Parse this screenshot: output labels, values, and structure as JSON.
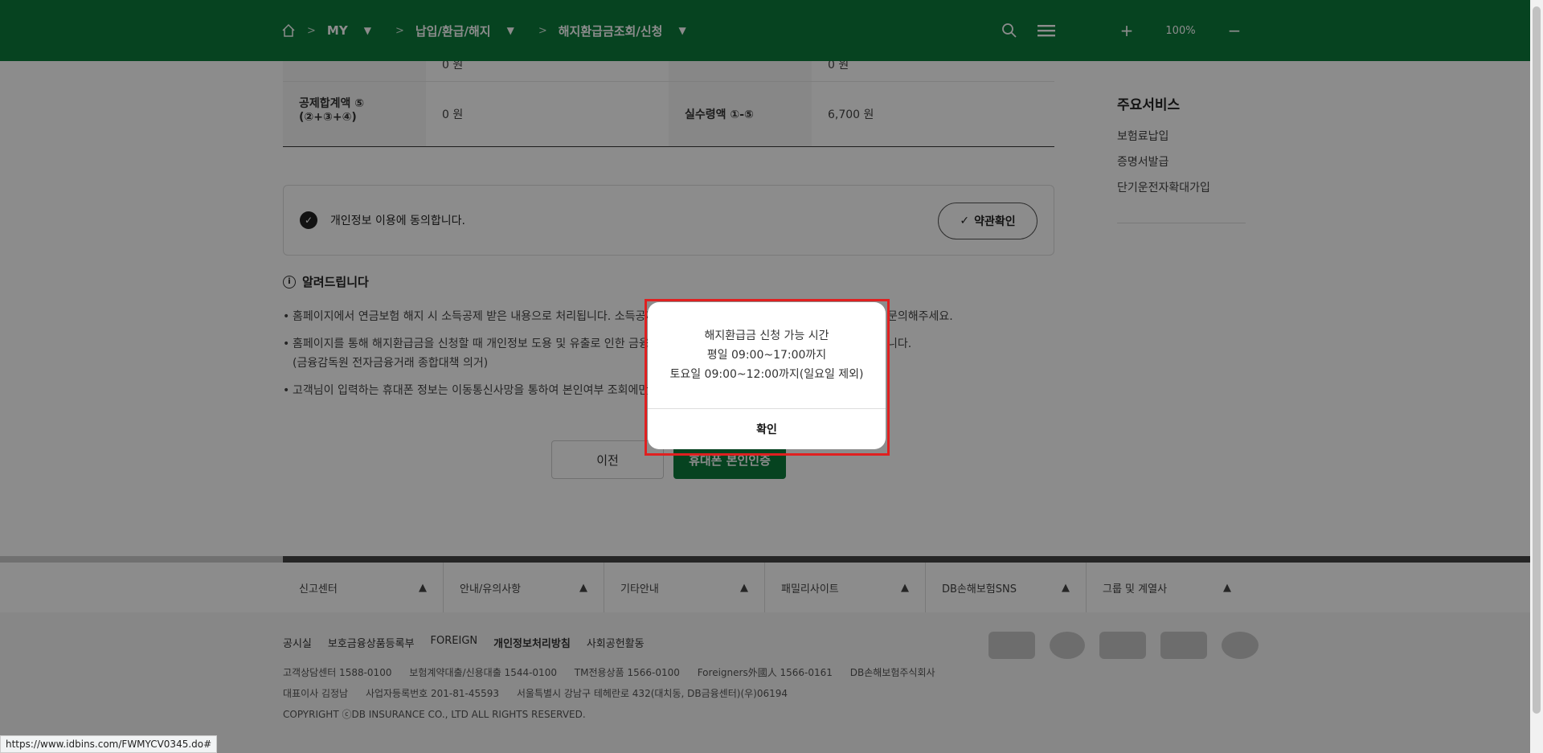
{
  "header": {
    "breadcrumbs": [
      "MY",
      "납입/환급/해지",
      "해지환급금조회/신청"
    ],
    "zoom_value": "100%",
    "zoom_plus": "+",
    "zoom_minus": "−",
    "drop_glyph": "▼",
    "sep_glyph": ">"
  },
  "table": {
    "row1": {
      "label1": "공제합계액 ⑤\n(②+③+④)",
      "value1": "0 원",
      "label2": "실수령액 ①-⑤",
      "value2": "6,700 원"
    },
    "partial_value1": "0 원",
    "partial_value2": "0 원"
  },
  "consent": {
    "text": "개인정보 이용에 동의합니다.",
    "terms_button": "약관확인"
  },
  "notice": {
    "title": "알려드립니다",
    "items": [
      "홈페이지에서 연금보험 해지 시 소득공제 받은 내용으로 처리됩니다. 소득공제",
      "홈페이지를 통해 해지환급금을 신청할 때 개인정보 도용 및 유출로 인한 금융사",
      "고객님이 입력하는 휴대폰 정보는 이동통신사망을 통하여 본인여부 조회에만"
    ],
    "item2_sub": "(금융감독원 전자금융거래 종합대책 의거)",
    "item1_tail": "문의해주세요.",
    "item2_tail": "니다."
  },
  "buttons": {
    "prev": "이전",
    "auth": "휴대폰 본인인증"
  },
  "aside": {
    "title": "주요서비스",
    "links": [
      "보험료납입",
      "증명서발급",
      "단기운전자확대가입"
    ]
  },
  "footer": {
    "nav": [
      "신고센터",
      "안내/유의사항",
      "기타안내",
      "패밀리사이트",
      "DB손해보험SNS",
      "그룹 및 계열사"
    ],
    "nav_glyph": "▲",
    "links": [
      "공시실",
      "보호금융상품등록부",
      "FOREIGN",
      "개인정보처리방침",
      "사회공헌활동"
    ],
    "line1": [
      "고객상담센터 1588-0100",
      "보험계약대출/신용대출 1544-0100",
      "TM전용상품 1566-0100",
      "Foreigners外國人 1566-0161",
      "DB손해보험주식회사"
    ],
    "line2": [
      "대표이사 김정남",
      "사업자등록번호 201-81-45593",
      "서울특별시 강남구 테헤란로 432(대치동, DB금융센터)(우)06194"
    ],
    "copyright": "COPYRIGHT ⓒDB INSURANCE CO., LTD ALL RIGHTS RESERVED."
  },
  "modal": {
    "lines": [
      "해지환급금 신청 가능 시간",
      "평일 09:00~17:00까지",
      "토요일 09:00~12:00까지(일요일 제외)"
    ],
    "confirm": "확인"
  },
  "status_url": "https://www.idbins.com/FWMYCV0345.do#"
}
